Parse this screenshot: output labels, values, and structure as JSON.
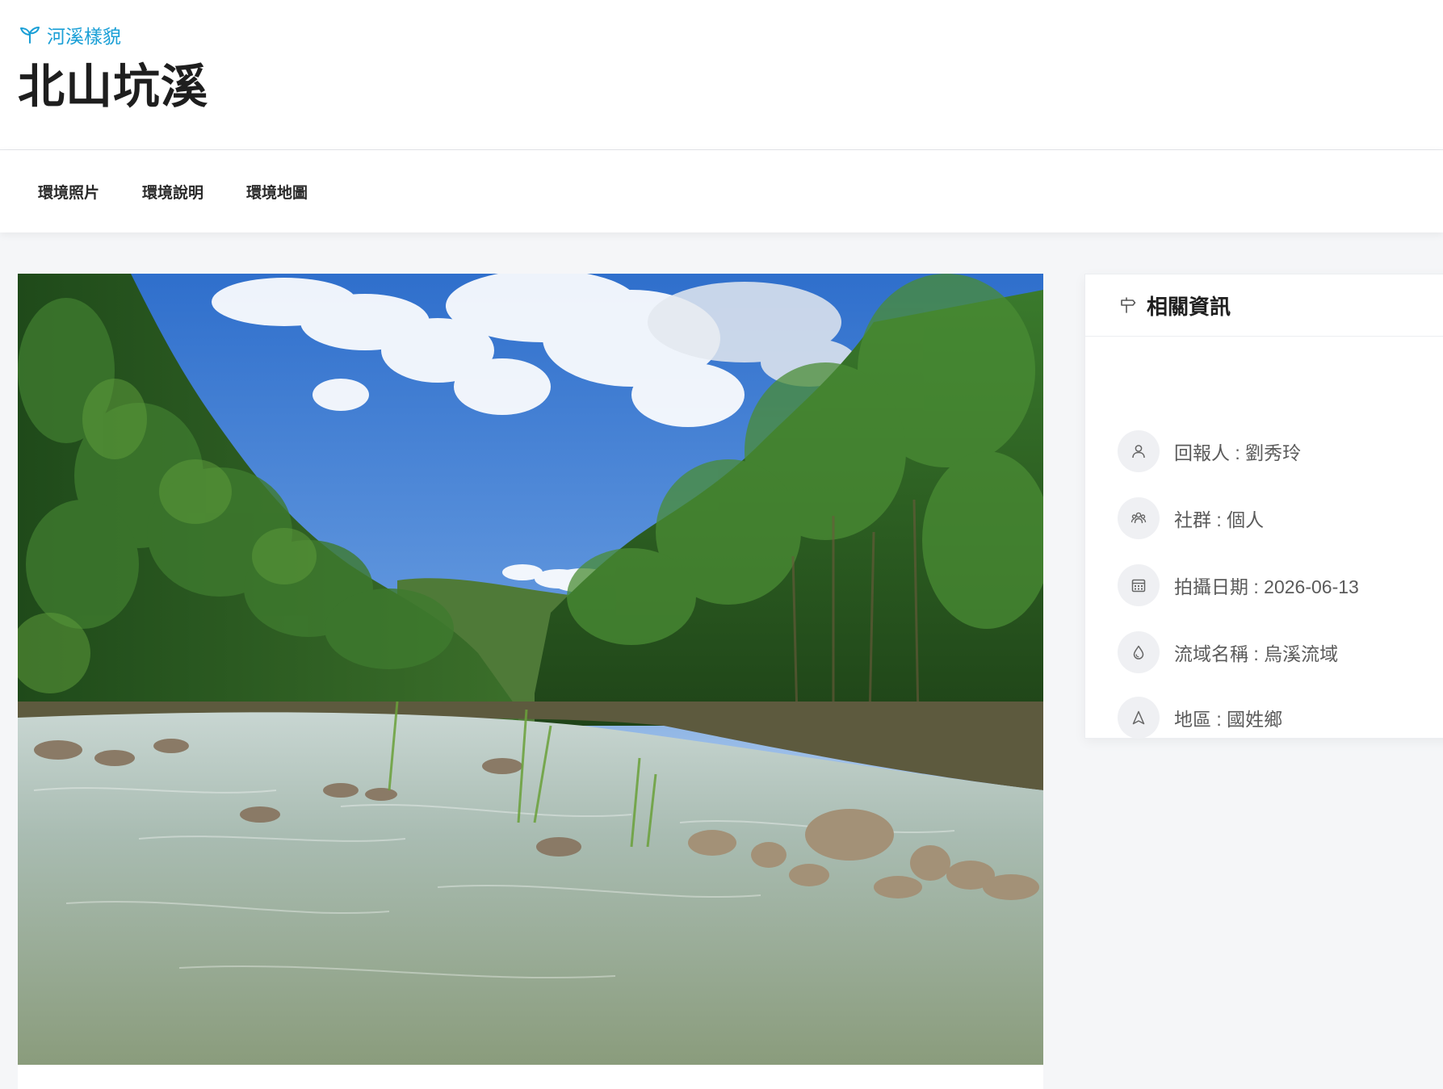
{
  "header": {
    "category": "河溪樣貌",
    "category_icon": "river-plant-icon",
    "title": "北山坑溪"
  },
  "tabs": [
    {
      "label": "環境照片"
    },
    {
      "label": "環境說明"
    },
    {
      "label": "環境地圖"
    }
  ],
  "photo": {
    "subject": "river-landscape-photo"
  },
  "sidebar": {
    "title": "相關資訊",
    "title_icon": "signpost-icon",
    "items": [
      {
        "icon": "person-icon",
        "text": "回報人 : 劉秀玲"
      },
      {
        "icon": "group-icon",
        "text": "社群 : 個人"
      },
      {
        "icon": "calendar-icon",
        "text": "拍攝日期 : 2026-06-13"
      },
      {
        "icon": "water-drop-icon",
        "text": "流域名稱 : 烏溪流域"
      },
      {
        "icon": "navigation-icon",
        "text": "地區 : 國姓鄉"
      }
    ]
  },
  "colors": {
    "accent": "#1a9fd6",
    "background": "#f5f6f8",
    "icon_circle": "#eff0f3"
  }
}
